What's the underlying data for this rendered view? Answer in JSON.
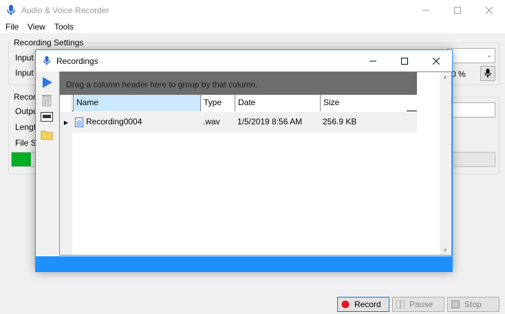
{
  "main": {
    "title": "Audio & Voice Recorder",
    "menu": [
      "File",
      "View",
      "Tools"
    ],
    "recording_settings_label": "Recording Settings",
    "input1_label": "Input",
    "input2_label": "Input",
    "input_level": "0 %",
    "recording_group_label": "Recor",
    "output_label": "Outpu",
    "length_label": "Lengt",
    "filesize_label": "File S",
    "buttons": {
      "record": "Record",
      "pause": "Pause",
      "stop": "Stop"
    }
  },
  "dialog": {
    "title": "Recordings",
    "group_hint": "Drag a column header here to group by that column.",
    "columns": [
      "Name",
      "Type",
      "Date",
      "Size"
    ],
    "rows": [
      {
        "name": "Recording0004",
        "type": ".wav",
        "date": "1/5/2019 8:56 AM",
        "size": "256.9 KB"
      }
    ]
  },
  "colors": {
    "accent": "#1e90ff",
    "progress": "#06b025",
    "group_panel": "#6d6d6d",
    "selected_header": "#cce8ff",
    "record_red": "#e81123"
  },
  "icons": {
    "app": "microphone-icon",
    "play": "play-icon",
    "delete": "trash-icon",
    "info": "info-icon",
    "folder": "folder-icon"
  }
}
